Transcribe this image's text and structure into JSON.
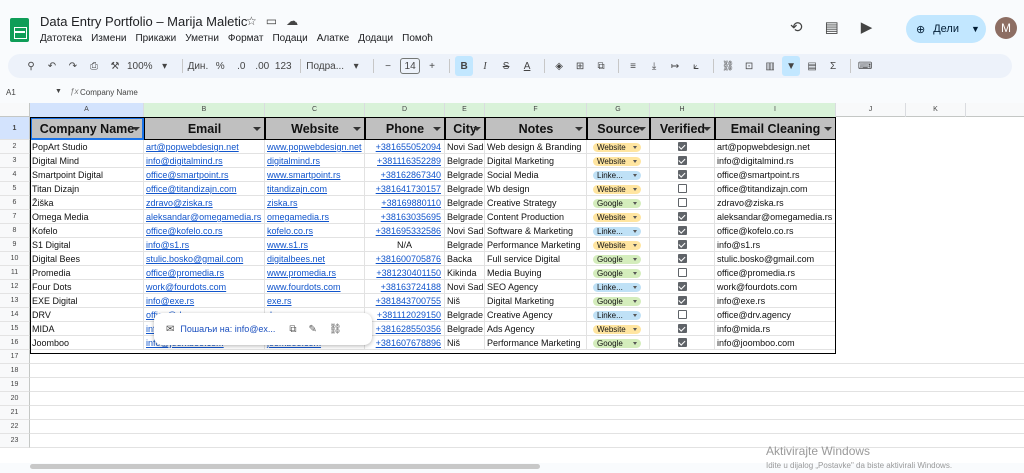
{
  "title": "Data Entry Portfolio – Marija Maletic",
  "menu": [
    "Датотека",
    "Измени",
    "Прикажи",
    "Уметни",
    "Формат",
    "Подаци",
    "Алатке",
    "Додаци",
    "Помоћ"
  ],
  "share_label": "Дели",
  "avatar_letter": "M",
  "toolbar": {
    "zoom": "100%",
    "currency": "Дин.",
    "percent": "%",
    "dec_decrease": ".0",
    "dec_increase": ".00",
    "format_123": "123",
    "font": "Подра...",
    "font_size": "14"
  },
  "name_box": "A1",
  "formula_value": "Company Name",
  "columns": [
    "A",
    "B",
    "C",
    "D",
    "E",
    "F",
    "G",
    "H",
    "I",
    "J",
    "K"
  ],
  "row_numbers": [
    "1",
    "2",
    "3",
    "4",
    "5",
    "6",
    "7",
    "8",
    "9",
    "10",
    "11",
    "12",
    "13",
    "14",
    "15",
    "16",
    "17",
    "18",
    "19",
    "20",
    "21",
    "22",
    "23"
  ],
  "headers": [
    "Company Name",
    "Email",
    "Website",
    "Phone",
    "City",
    "Notes",
    "Source",
    "Verified",
    "Email Cleaning"
  ],
  "rows": [
    {
      "company": "PopArt Studio",
      "email": "art@popwebdesign.net",
      "website": "www.popwebdesign.net",
      "phone": "+381655052094",
      "city": "Novi Sad",
      "notes": "Web design & Branding",
      "source": "Website",
      "verified": true,
      "clean": "art@popwebdesign.net"
    },
    {
      "company": "Digital Mind",
      "email": "info@digitalmind.rs",
      "website": "digitalmind.rs",
      "phone": "+381116352289",
      "city": "Belgrade",
      "notes": "Digital Marketing",
      "source": "Website",
      "verified": true,
      "clean": "info@digitalmind.rs"
    },
    {
      "company": "Smartpoint Digital",
      "email": "office@smartpoint.rs",
      "website": "www.smartpoint.rs",
      "phone": "+38162867340",
      "city": "Belgrade",
      "notes": "Social Media",
      "source": "Linke...",
      "verified": true,
      "clean": "office@smartpoint.rs"
    },
    {
      "company": "Titan Dizajn",
      "email": "office@titandizajn.com",
      "website": "titandizajn.com",
      "phone": "+381641730157",
      "city": "Belgrade",
      "notes": "Wb design",
      "source": "Website",
      "verified": false,
      "clean": "office@titandizajn.com"
    },
    {
      "company": "Žiška",
      "email": "zdravo@ziska.rs",
      "website": "ziska.rs",
      "phone": "+38169880110",
      "city": "Belgrade",
      "notes": "Creative Strategy",
      "source": "Google",
      "verified": false,
      "clean": "zdravo@ziska.rs"
    },
    {
      "company": "Omega Media",
      "email": "aleksandar@omegamedia.rs",
      "website": "omegamedia.rs",
      "phone": "+38163035695",
      "city": "Belgrade",
      "notes": "Content Production",
      "source": "Website",
      "verified": true,
      "clean": "aleksandar@omegamedia.rs"
    },
    {
      "company": "Kofelo",
      "email": "office@kofelo.co.rs",
      "website": "kofelo.co.rs",
      "phone": "+381695332586",
      "city": "Novi Sad",
      "notes": "Software & Marketing",
      "source": "Linke...",
      "verified": true,
      "clean": "office@kofelo.co.rs"
    },
    {
      "company": "S1 Digital",
      "email": "info@s1.rs",
      "website": "www.s1.rs",
      "phone": "N/A",
      "city": "Belgrade",
      "notes": "Performance Marketing",
      "source": "Website",
      "verified": true,
      "clean": "info@s1.rs"
    },
    {
      "company": "Digital Bees",
      "email": "stulic.bosko@gmail.com",
      "website": "digitalbees.net",
      "phone": "+381600705876",
      "city": "Backa",
      "notes": "Full service Digital",
      "source": "Google",
      "verified": true,
      "clean": "stulic.bosko@gmail.com"
    },
    {
      "company": "Promedia",
      "email": "office@promedia.rs",
      "website": "www.promedia.rs",
      "phone": "+381230401150",
      "city": "Kikinda",
      "notes": "Media Buying",
      "source": "Google",
      "verified": false,
      "clean": "office@promedia.rs"
    },
    {
      "company": "Four Dots",
      "email": "work@fourdots.com",
      "website": "www.fourdots.com",
      "phone": "+38163724188",
      "city": "Novi Sad",
      "notes": "SEO Agency",
      "source": "Linke...",
      "verified": true,
      "clean": "work@fourdots.com"
    },
    {
      "company": "EXE Digital",
      "email": "info@exe.rs",
      "website": "exe.rs",
      "phone": "+381843700755",
      "city": "Niš",
      "notes": "Digital Marketing",
      "source": "Google",
      "verified": true,
      "clean": "info@exe.rs"
    },
    {
      "company": "DRV",
      "email": "office@drv.agency",
      "website": "drv.agency",
      "phone": "+381112029150",
      "city": "Belgrade",
      "notes": "Creative Agency",
      "source": "Linke...",
      "verified": false,
      "clean": "office@drv.agency"
    },
    {
      "company": "MIDA",
      "email": "info@mida.rs",
      "website": "mida.rs",
      "phone": "+381628550356",
      "city": "Belgrade",
      "notes": "Ads Agency",
      "source": "Website",
      "verified": true,
      "clean": "info@mida.rs"
    },
    {
      "company": "Joomboo",
      "email": "info@joomboo.com",
      "website": "joomboo.com",
      "phone": "+381607678896",
      "city": "Niš",
      "notes": "Performance Marketing",
      "source": "Google",
      "verified": true,
      "clean": "info@joomboo.com"
    }
  ],
  "tooltip": {
    "label": "Пошаљи на: info@ex..."
  },
  "watermark": {
    "line1": "Aktivirajte Windows",
    "line2": "Idite u dijalog „Postavke\" da biste aktivirali Windows."
  },
  "colors": {
    "header_bg": "#c0c0c0",
    "chip_website": "#ffe5a0",
    "chip_linkedin": "#bfe1f6",
    "chip_google": "#d4edbc",
    "link": "#1155cc",
    "share": "#c2e7ff"
  }
}
